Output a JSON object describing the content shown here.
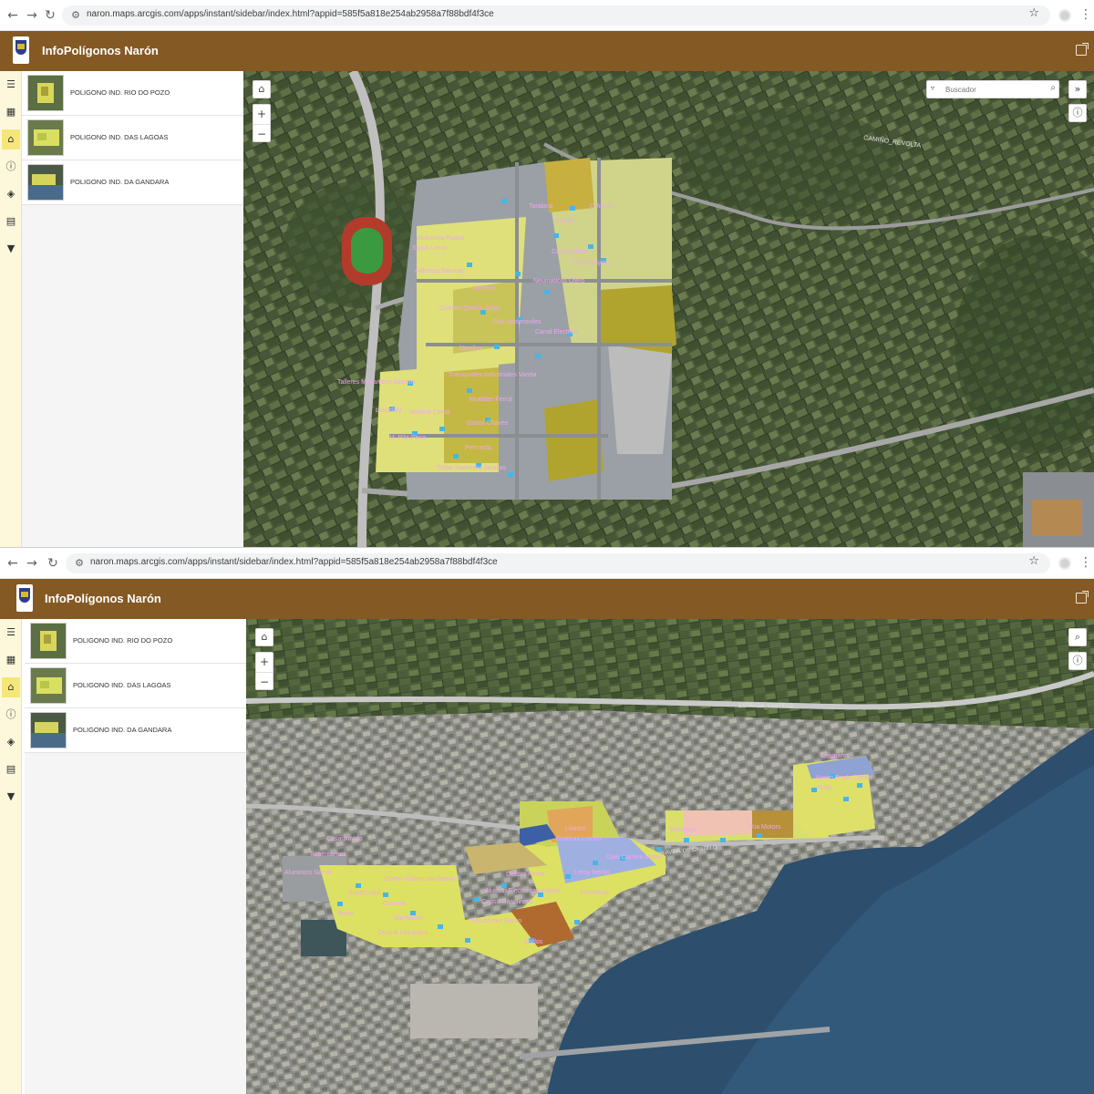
{
  "browser": {
    "url": "naron.maps.arcgis.com/apps/instant/sidebar/index.html?appid=585f5a818e254ab2958a7f88bdf4f3ce"
  },
  "app": {
    "title": "InfoPolígonos Narón"
  },
  "sidebar": {
    "cards": [
      {
        "label": "POLIGONO IND. RIO DO POZO"
      },
      {
        "label": "POLIGONO IND. DAS LAGOAS"
      },
      {
        "label": "POLIGONO IND. DA GANDARA"
      }
    ]
  },
  "toolbar": {
    "icons": [
      "list-icon",
      "qr-grid-icon",
      "bookmark-icon",
      "info-icon",
      "layers-icon",
      "legend-icon",
      "filter-icon"
    ],
    "active": "bookmark-icon"
  },
  "map_a": {
    "search_placeholder": "Buscador",
    "labels": {
      "l1": "Taralans",
      "l2": "Ofhaces",
      "l3": "Tivanor",
      "l4": "Aluminios Puasa",
      "l5": "Surso Lovac",
      "l6": "Casa Bolmar",
      "l7": "Aldomas Saurisa",
      "l8": "Yoliaz Bayme",
      "l9": "Neumaticos Otero",
      "l10": "Alucesa",
      "l11": "Giudoni Quartz Spain",
      "l12": "Ofax Automoviles",
      "l13": "Canal Electrica",
      "l14": "Neodyn",
      "l15": "Talleres Mecanicos Gorelas",
      "l16": "Transportes Industriales Varela",
      "l17": "Muebles Ferrol",
      "l18": "Lavadalu",
      "l19": "Madera Cerda",
      "l20": "Gasoil Chaves",
      "l21": "M. Pita Pena",
      "l22": "Perrunda",
      "l23": "Trabe Saavedra Jarallas",
      "road": "CAMIÑO_REVOLTA"
    }
  },
  "map_b": {
    "labels": {
      "l1": "Crisgrafos",
      "l2": "Naron Trade Center",
      "l3": "Rolla",
      "l4": "Biotarma",
      "l5": "Kia Motors",
      "l6": "Lilaidol",
      "l7": "Casa Jurado",
      "l8": "Graficas Lombo",
      "l9": "Opel Carrera Maria",
      "l10": "Supercarnes",
      "l11": "Leroy Merlin",
      "l12": "Aluminios Naron",
      "l13": "Centro Comercial Odeon",
      "l14": "Dakota Ferrol",
      "l15": "Supercopia",
      "l16": "Aluman Electrodomesticos",
      "l17": "Cepsa Gasolinera",
      "l18": "Ferreteria",
      "l19": "Soluciones Naron",
      "l20": "Cosmos",
      "l21": "Rodal",
      "l22": "Cirdos",
      "l23": "Bar Naron",
      "l24": "Central Hidraulica",
      "road1": "AVDA. DE CASTELO",
      "road2": "ESTRADA_CASTELO"
    }
  }
}
